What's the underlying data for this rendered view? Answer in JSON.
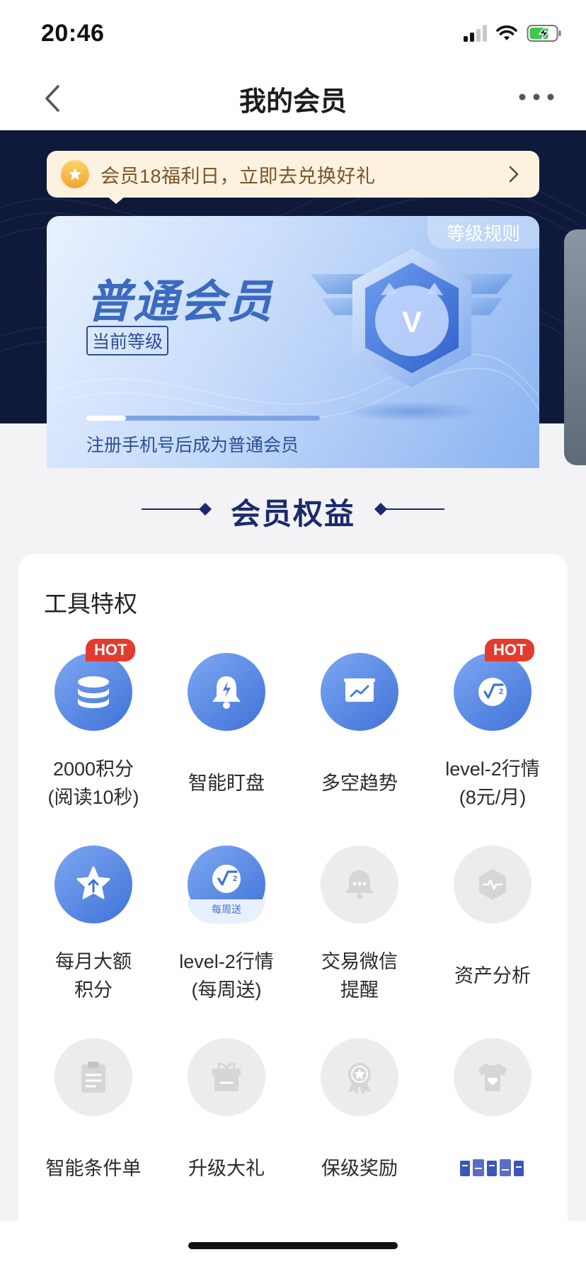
{
  "status_bar": {
    "time": "20:46"
  },
  "nav": {
    "title": "我的会员"
  },
  "notice": {
    "text": "会员18福利日，立即去兑换好礼"
  },
  "level_card": {
    "rules_label": "等级规则",
    "level_name": "普通会员",
    "current_tag": "当前等级",
    "progress_fraction": 0.17,
    "progress_text": "注册手机号后成为普通会员",
    "badge_letter": "V"
  },
  "section": {
    "title": "会员权益"
  },
  "benefits": {
    "title": "工具特权",
    "items": [
      {
        "label": "2000积分\n(阅读10秒)",
        "icon": "coins-stack-icon",
        "active": true,
        "hot": "HOT"
      },
      {
        "label": "智能盯盘",
        "icon": "bell-icon",
        "active": true
      },
      {
        "label": "多空趋势",
        "icon": "trend-chart-icon",
        "active": true
      },
      {
        "label": "level-2行情\n(8元/月)",
        "icon": "level2-icon",
        "active": true,
        "hot": "HOT"
      },
      {
        "label": "每月大额\n积分",
        "icon": "star-up-icon",
        "active": true
      },
      {
        "label": "level-2行情\n(每周送)",
        "icon": "level2-weekly-icon",
        "active": true,
        "band": "每周送"
      },
      {
        "label": "交易微信\n提醒",
        "icon": "chat-bell-icon",
        "active": false
      },
      {
        "label": "资产分析",
        "icon": "hexagon-pulse-icon",
        "active": false
      },
      {
        "label": "智能条件单",
        "icon": "clipboard-icon",
        "active": false
      },
      {
        "label": "升级大礼",
        "icon": "gift-icon",
        "active": false
      },
      {
        "label": "保级奖励",
        "icon": "award-icon",
        "active": false
      },
      {
        "label": "",
        "icon": "tshirt-icon",
        "active": false
      }
    ]
  }
}
